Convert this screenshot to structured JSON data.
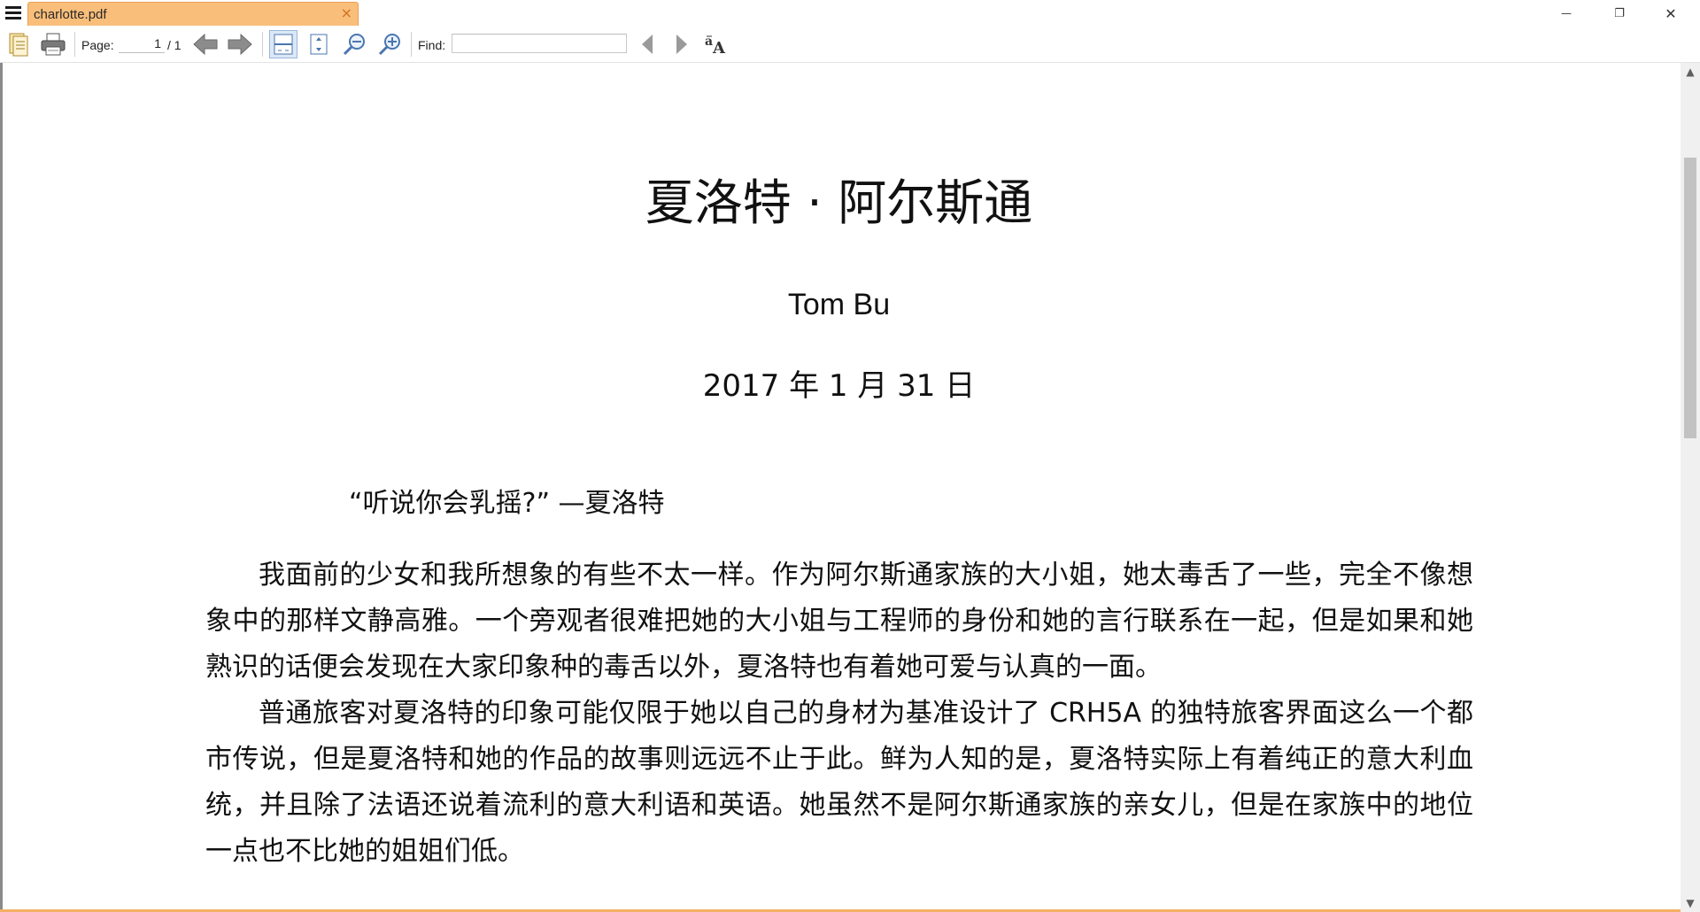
{
  "titlebar": {
    "tab_title": "charlotte.pdf",
    "tab_close": "×",
    "minimize": "—",
    "restore": "❐",
    "close": "✕"
  },
  "toolbar": {
    "page_label": "Page:",
    "page_current": "1",
    "page_total": "/ 1",
    "find_label": "Find:",
    "find_value": ""
  },
  "document": {
    "title": "夏洛特 · 阿尔斯通",
    "author": "Tom Bu",
    "date": "2017 年 1 月 31 日",
    "epigraph": "“听说你会乳摇?” —夏洛特",
    "paragraphs": [
      "我面前的少女和我所想象的有些不太一样。作为阿尔斯通家族的大小姐，她太毒舌了一些，完全不像想象中的那样文静高雅。一个旁观者很难把她的大小姐与工程师的身份和她的言行联系在一起，但是如果和她熟识的话便会发现在大家印象种的毒舌以外，夏洛特也有着她可爱与认真的一面。",
      "普通旅客对夏洛特的印象可能仅限于她以自己的身材为基准设计了 CRH5A 的独特旅客界面这么一个都市传说，但是夏洛特和她的作品的故事则远远不止于此。鲜为人知的是，夏洛特实际上有着纯正的意大利血统，并且除了法语还说着流利的意大利语和英语。她虽然不是阿尔斯通家族的亲女儿，但是在家族中的地位一点也不比她的姐姐们低。"
    ]
  },
  "icons": {
    "menu": "hamburger-icon",
    "open": "open-document-icon",
    "print": "print-icon",
    "prev_page": "previous-page-icon",
    "next_page": "next-page-icon",
    "fit_page": "fit-page-icon",
    "fit_width": "fit-width-icon",
    "zoom_out": "zoom-out-icon",
    "zoom_in": "zoom-in-icon",
    "find_prev": "find-previous-icon",
    "find_next": "find-next-icon",
    "match_case": "match-case-icon"
  },
  "colors": {
    "tab_background": "#f9be7a",
    "accent": "#f4b063",
    "scroll_thumb": "#c2c2c2"
  }
}
